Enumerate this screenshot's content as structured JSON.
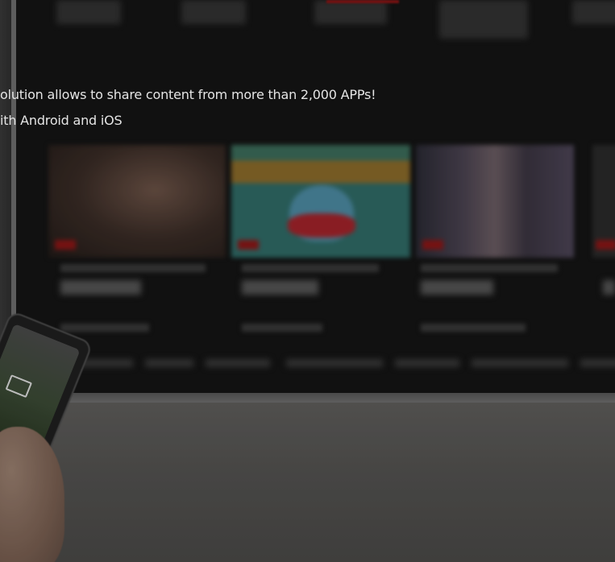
{
  "overlay": {
    "line1": "olution allows to share content from more than 2,000 APPs!",
    "line2": "ith Android and iOS"
  },
  "colors": {
    "screen": "#141414",
    "accent": "#8a1414",
    "text": "#e4e4e4"
  }
}
